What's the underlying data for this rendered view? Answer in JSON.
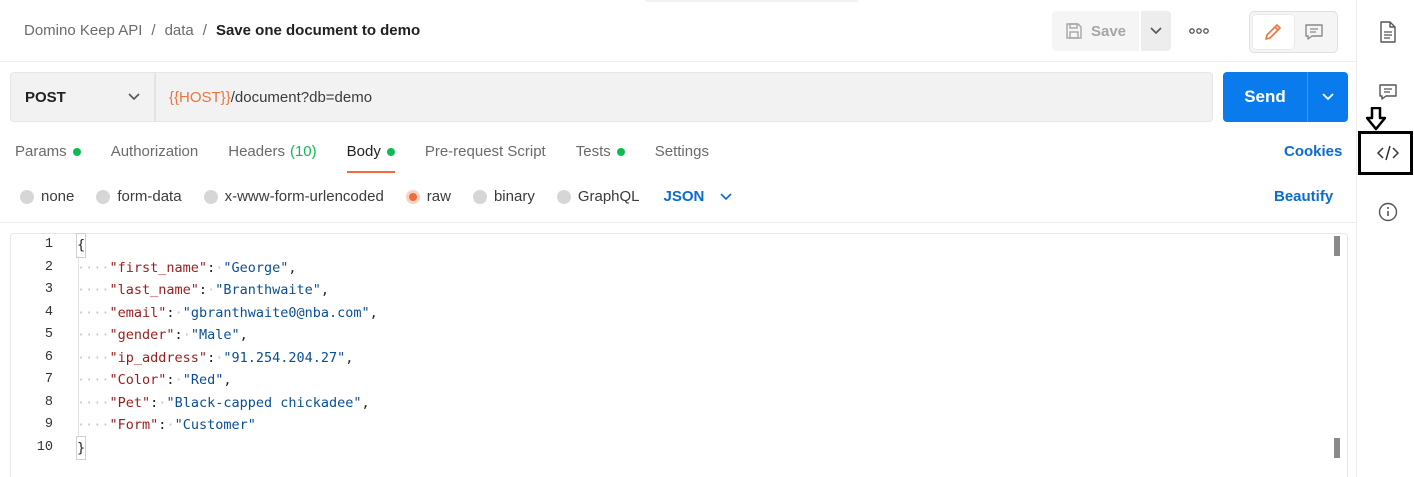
{
  "breadcrumb": {
    "items": [
      "Domino Keep API",
      "data"
    ],
    "separator": "/",
    "current": "Save one document to demo"
  },
  "toolbar": {
    "save_label": "Save",
    "more_label": "ooo"
  },
  "request": {
    "method": "POST",
    "url_variable": "{{HOST}}",
    "url_path": "/document?db=demo",
    "send_label": "Send"
  },
  "tabs": [
    {
      "label": "Params",
      "dot": true
    },
    {
      "label": "Authorization"
    },
    {
      "label": "Headers",
      "count": "(10)"
    },
    {
      "label": "Body",
      "dot": true,
      "active": true
    },
    {
      "label": "Pre-request Script"
    },
    {
      "label": "Tests",
      "dot": true
    },
    {
      "label": "Settings"
    }
  ],
  "cookies_label": "Cookies",
  "body_types": [
    {
      "label": "none"
    },
    {
      "label": "form-data"
    },
    {
      "label": "x-www-form-urlencoded"
    },
    {
      "label": "raw",
      "selected": true
    },
    {
      "label": "binary"
    },
    {
      "label": "GraphQL"
    }
  ],
  "language": "JSON",
  "beautify_label": "Beautify",
  "editor": {
    "line_numbers": [
      "1",
      "2",
      "3",
      "4",
      "5",
      "6",
      "7",
      "8",
      "9",
      "10"
    ],
    "lines": [
      {
        "open": "{"
      },
      {
        "key": "\"first_name\"",
        "value": "\"George\"",
        "comma": true
      },
      {
        "key": "\"last_name\"",
        "value": "\"Branthwaite\"",
        "comma": true
      },
      {
        "key": "\"email\"",
        "value": "\"gbranthwaite0@nba.com\"",
        "comma": true
      },
      {
        "key": "\"gender\"",
        "value": "\"Male\"",
        "comma": true
      },
      {
        "key": "\"ip_address\"",
        "value": "\"91.254.204.27\"",
        "comma": true
      },
      {
        "key": "\"Color\"",
        "value": "\"Red\"",
        "comma": true
      },
      {
        "key": "\"Pet\"",
        "value": "\"Black-capped chickadee\"",
        "comma": true
      },
      {
        "key": "\"Form\"",
        "value": "\"Customer\"",
        "comma": false
      },
      {
        "close": "}"
      }
    ]
  },
  "colors": {
    "accent": "#097bed",
    "active_tab": "#f26b3a",
    "dot": "#0cbb52",
    "variable": "#e8763e",
    "json_key": "#9b1c1c",
    "json_string": "#0a4e96"
  },
  "rail": {
    "icons": [
      "document-icon",
      "comment-icon",
      "code-icon",
      "info-icon"
    ]
  }
}
